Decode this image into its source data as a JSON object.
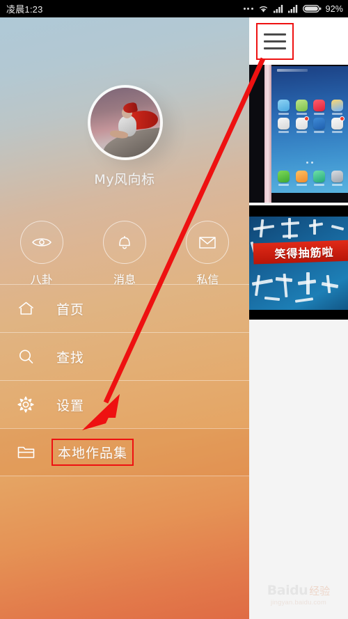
{
  "status_bar": {
    "time": "凌晨1:23",
    "battery": "92%",
    "icons": [
      "more-dots-icon",
      "wifi-icon",
      "signal-icon",
      "signal-icon",
      "battery-icon"
    ]
  },
  "right_panel": {
    "hamburger": "menu-hamburger-icon",
    "thumbnails": [
      {
        "name": "phone-homescreen-photo",
        "caption": ""
      },
      {
        "name": "video-thumbnail",
        "banner_text": "笑得抽筋啦"
      }
    ],
    "watermark": {
      "brand": "Baidu",
      "brand_cn": "经验",
      "url": "jingyan.baidu.com"
    }
  },
  "drawer": {
    "profile": {
      "username": "My风向标",
      "avatar": "user-avatar"
    },
    "actions": [
      {
        "icon": "eye-icon",
        "label": "八卦"
      },
      {
        "icon": "bell-icon",
        "label": "消息"
      },
      {
        "icon": "envelope-icon",
        "label": "私信"
      }
    ],
    "menu": [
      {
        "icon": "home-icon",
        "label": "首页",
        "selected": false,
        "highlighted": false
      },
      {
        "icon": "search-icon",
        "label": "查找",
        "selected": false,
        "highlighted": false
      },
      {
        "icon": "gear-icon",
        "label": "设置",
        "selected": false,
        "highlighted": false
      },
      {
        "icon": "folder-icon",
        "label": "本地作品集",
        "selected": true,
        "highlighted": true
      }
    ]
  },
  "annotation": {
    "arrow_color": "#ee1111",
    "highlight_color": "#ee1111"
  }
}
